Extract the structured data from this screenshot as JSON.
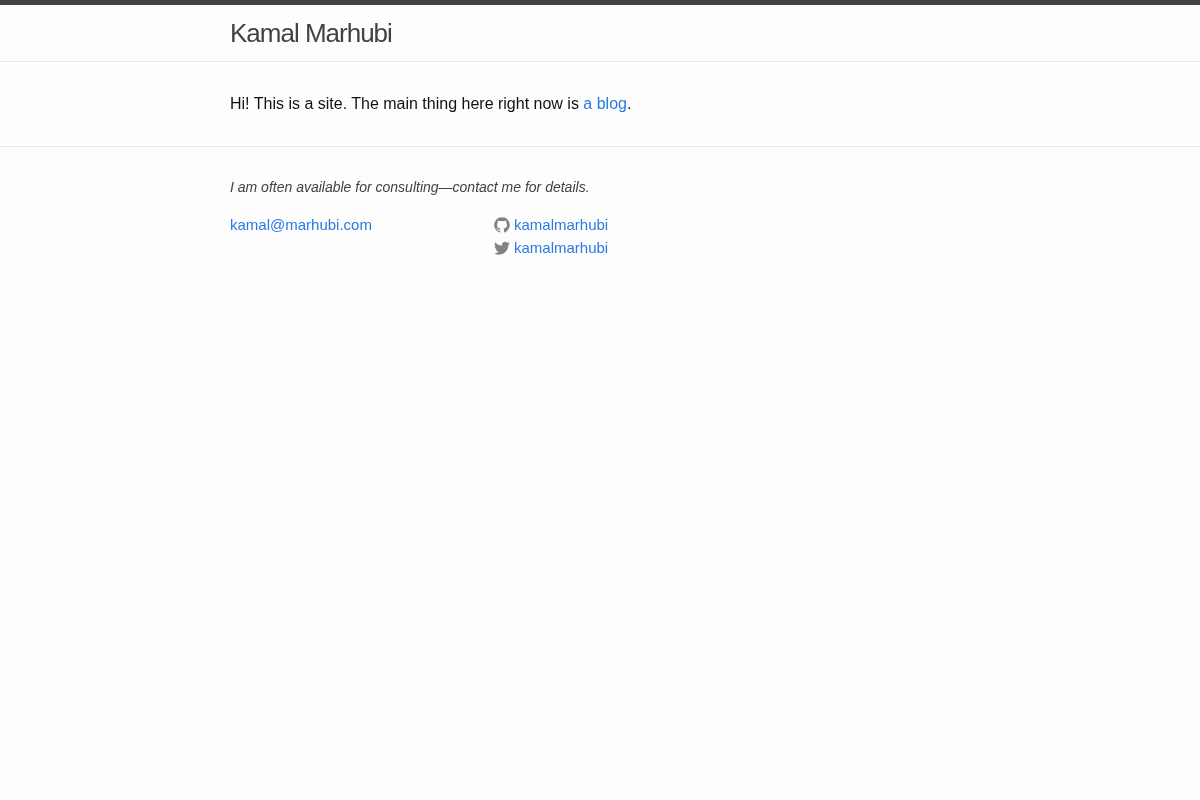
{
  "header": {
    "site_title": "Kamal Marhubi"
  },
  "intro": {
    "text_before": "Hi! This is a site. The main thing here right now is ",
    "link": "a blog",
    "text_after": "."
  },
  "footer": {
    "note": "I am often available for consulting—contact me for details.",
    "email": "kamal@marhubi.com",
    "social": [
      {
        "kind": "github",
        "handle": "kamalmarhubi"
      },
      {
        "kind": "twitter",
        "handle": "kamalmarhubi"
      }
    ]
  }
}
